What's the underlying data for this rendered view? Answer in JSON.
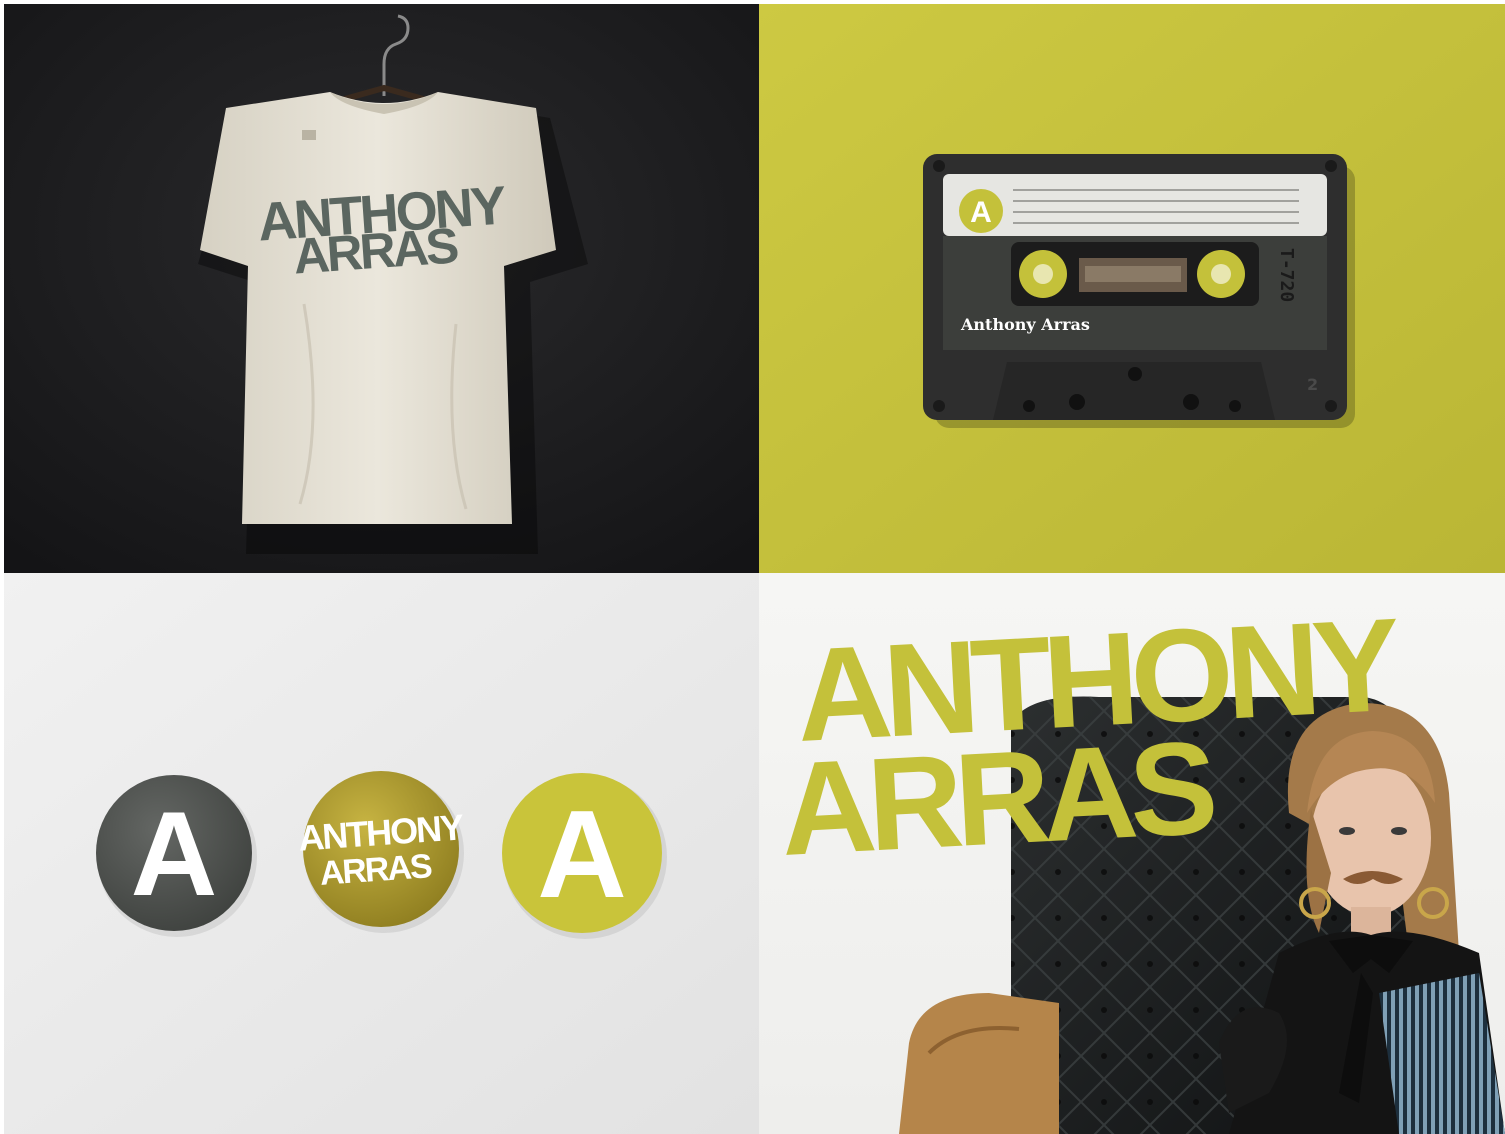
{
  "brand": {
    "line1": "ANTHONY",
    "line2": "ARRAS",
    "monogram": "A"
  },
  "cassette": {
    "artist_label": "Anthony Arras",
    "tape_code": "T-720",
    "side_label": "2"
  },
  "colors": {
    "dark_bg": "#19191b",
    "accent_yellow": "#c4c13a",
    "shirt": "#e4e0d4",
    "shirt_print": "#5b6660",
    "sticker_gray": "#4f524f",
    "sticker_gold": "#a8952c",
    "paper": "#ececec"
  }
}
